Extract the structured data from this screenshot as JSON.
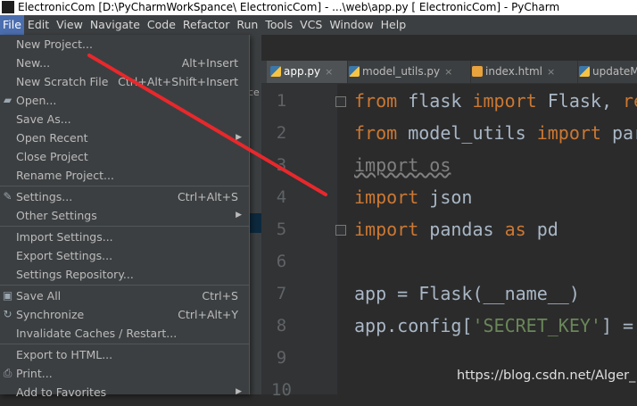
{
  "window": {
    "title": "ElectronicCom [D:\\PyCharmWorkSpance\\ ElectronicCom] - ...\\web\\app.py [ ElectronicCom] - PyCharm"
  },
  "menubar": [
    "File",
    "Edit",
    "View",
    "Navigate",
    "Code",
    "Refactor",
    "Run",
    "Tools",
    "VCS",
    "Window",
    "Help"
  ],
  "file_menu": {
    "items": [
      {
        "label": "New Project...",
        "shortcut": "",
        "icon": "",
        "submenu": false,
        "highlighted": false
      },
      {
        "label": "New...",
        "shortcut": "Alt+Insert",
        "icon": "",
        "submenu": false
      },
      {
        "label": "New Scratch File",
        "shortcut": "Ctrl+Alt+Shift+Insert",
        "icon": "",
        "submenu": false
      },
      {
        "label": "Open...",
        "shortcut": "",
        "icon": "folder-icon",
        "submenu": false
      },
      {
        "label": "Save As...",
        "shortcut": "",
        "icon": "",
        "submenu": false
      },
      {
        "label": "Open Recent",
        "shortcut": "",
        "icon": "",
        "submenu": true
      },
      {
        "label": "Close Project",
        "shortcut": "",
        "icon": "",
        "submenu": false
      },
      {
        "label": "Rename Project...",
        "shortcut": "",
        "icon": "",
        "submenu": false
      },
      {
        "label": "Settings...",
        "shortcut": "Ctrl+Alt+S",
        "icon": "wrench-icon",
        "submenu": false
      },
      {
        "label": "Other Settings",
        "shortcut": "",
        "icon": "",
        "submenu": true
      },
      {
        "label": "Import Settings...",
        "shortcut": "",
        "icon": "",
        "submenu": false
      },
      {
        "label": "Export Settings...",
        "shortcut": "",
        "icon": "",
        "submenu": false
      },
      {
        "label": "Settings Repository...",
        "shortcut": "",
        "icon": "",
        "submenu": false
      },
      {
        "label": "Save All",
        "shortcut": "Ctrl+S",
        "icon": "save-icon",
        "submenu": false
      },
      {
        "label": "Synchronize",
        "shortcut": "Ctrl+Alt+Y",
        "icon": "sync-icon",
        "submenu": false
      },
      {
        "label": "Invalidate Caches / Restart...",
        "shortcut": "",
        "icon": "",
        "submenu": false
      },
      {
        "label": "Export to HTML...",
        "shortcut": "",
        "icon": "",
        "submenu": false
      },
      {
        "label": "Print...",
        "shortcut": "",
        "icon": "print-icon",
        "submenu": false
      },
      {
        "label": "Add to Favorites",
        "shortcut": "",
        "icon": "",
        "submenu": true
      }
    ]
  },
  "tabs": [
    {
      "label": "app.py",
      "active": true,
      "type": "py"
    },
    {
      "label": "model_utils.py",
      "active": false,
      "type": "py"
    },
    {
      "label": "index.html",
      "active": false,
      "type": "html"
    },
    {
      "label": "updateMo",
      "active": false,
      "type": "py"
    }
  ],
  "side_text": "ce",
  "editor": {
    "line_numbers": [
      "1",
      "2",
      "3",
      "4",
      "5",
      "6",
      "7",
      "8",
      "9",
      "10"
    ],
    "lines": [
      [
        {
          "t": "from",
          "c": "kw"
        },
        {
          "t": " flask ",
          "c": ""
        },
        {
          "t": "import",
          "c": "kw"
        },
        {
          "t": " Flask, ",
          "c": ""
        },
        {
          "t": "re",
          "c": "kw"
        }
      ],
      [
        {
          "t": "from",
          "c": "kw"
        },
        {
          "t": " model_utils ",
          "c": ""
        },
        {
          "t": "import",
          "c": "kw"
        },
        {
          "t": " par",
          "c": ""
        }
      ],
      [
        {
          "t": "import os",
          "c": "unused"
        }
      ],
      [
        {
          "t": "import",
          "c": "kw"
        },
        {
          "t": " json",
          "c": ""
        }
      ],
      [
        {
          "t": "import",
          "c": "kw"
        },
        {
          "t": " pandas ",
          "c": ""
        },
        {
          "t": "as",
          "c": "kw"
        },
        {
          "t": " pd",
          "c": ""
        }
      ],
      [],
      [
        {
          "t": "app = Flask(__name__)",
          "c": ""
        }
      ],
      [
        {
          "t": "app.config[",
          "c": ""
        },
        {
          "t": "'SECRET_KEY'",
          "c": "str"
        },
        {
          "t": "] =",
          "c": ""
        }
      ],
      [],
      []
    ]
  },
  "watermark": "https://blog.csdn.net/Alger_",
  "colors": {
    "annotation": "#e8282c",
    "menu_highlight": "#4b6eaf"
  }
}
